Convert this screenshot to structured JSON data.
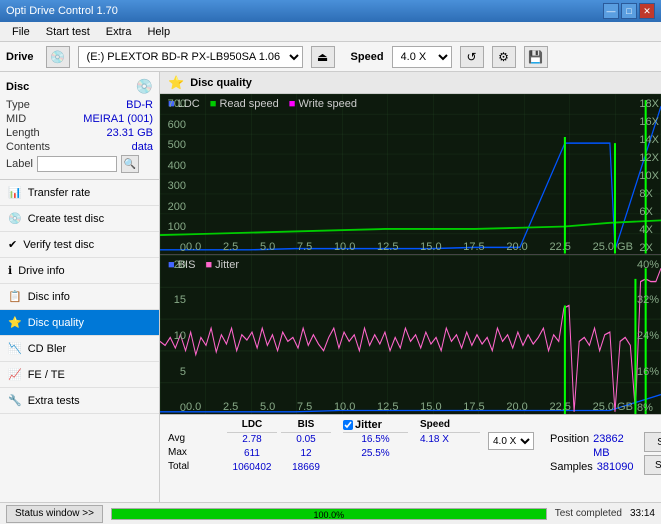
{
  "app": {
    "title": "Opti Drive Control 1.70",
    "min_btn": "—",
    "max_btn": "□",
    "close_btn": "✕"
  },
  "menu": {
    "items": [
      "File",
      "Start test",
      "Extra",
      "Help"
    ]
  },
  "drivebar": {
    "drive_label": "Drive",
    "drive_value": "(E:)  PLEXTOR BD-R  PX-LB950SA 1.06",
    "speed_label": "Speed",
    "speed_value": "4.0 X"
  },
  "disc": {
    "title": "Disc",
    "type_label": "Type",
    "type_val": "BD-R",
    "mid_label": "MID",
    "mid_val": "MEIRA1 (001)",
    "length_label": "Length",
    "length_val": "23.31 GB",
    "contents_label": "Contents",
    "contents_val": "data",
    "label_label": "Label"
  },
  "sidebar": {
    "items": [
      {
        "id": "transfer-rate",
        "label": "Transfer rate",
        "icon": "📊"
      },
      {
        "id": "create-test-disc",
        "label": "Create test disc",
        "icon": "💿"
      },
      {
        "id": "verify-test-disc",
        "label": "Verify test disc",
        "icon": "✔"
      },
      {
        "id": "drive-info",
        "label": "Drive info",
        "icon": "ℹ"
      },
      {
        "id": "disc-info",
        "label": "Disc info",
        "icon": "📋"
      },
      {
        "id": "disc-quality",
        "label": "Disc quality",
        "icon": "⭐",
        "active": true
      },
      {
        "id": "cd-bler",
        "label": "CD Bler",
        "icon": "📉"
      },
      {
        "id": "fe-te",
        "label": "FE / TE",
        "icon": "📈"
      },
      {
        "id": "extra-tests",
        "label": "Extra tests",
        "icon": "🔧"
      }
    ]
  },
  "chart_quality": {
    "title": "Disc quality",
    "legend": [
      {
        "label": "LDC",
        "color": "#0000ff"
      },
      {
        "label": "Read speed",
        "color": "#00aa00"
      },
      {
        "label": "Write speed",
        "color": "#ff00ff"
      }
    ],
    "y_max": 700,
    "y_right_max": 18,
    "x_max": 25.0,
    "y_labels_left": [
      "700",
      "600",
      "500",
      "400",
      "300",
      "200",
      "100",
      "0"
    ],
    "y_labels_right": [
      "18X",
      "16X",
      "14X",
      "12X",
      "10X",
      "8X",
      "6X",
      "4X",
      "2X"
    ],
    "x_labels": [
      "0.0",
      "2.5",
      "5.0",
      "7.5",
      "10.0",
      "12.5",
      "15.0",
      "17.5",
      "20.0",
      "22.5",
      "25.0 GB"
    ]
  },
  "chart_bis": {
    "legend": [
      {
        "label": "BIS",
        "color": "#0000ff"
      },
      {
        "label": "Jitter",
        "color": "#ff00aa"
      }
    ],
    "y_left_max": 20,
    "y_right_max": 40,
    "y_labels_left": [
      "20",
      "15",
      "10",
      "5",
      "0"
    ],
    "y_labels_right": [
      "40%",
      "32%",
      "24%",
      "16%",
      "8%"
    ],
    "x_labels": [
      "0.0",
      "2.5",
      "5.0",
      "7.5",
      "10.0",
      "12.5",
      "15.0",
      "17.5",
      "20.0",
      "22.5",
      "25.0 GB"
    ]
  },
  "stats": {
    "columns": [
      "",
      "LDC",
      "BIS",
      "",
      "Jitter",
      "Speed"
    ],
    "avg_label": "Avg",
    "max_label": "Max",
    "total_label": "Total",
    "ldc_avg": "2.78",
    "ldc_max": "611",
    "ldc_total": "1060402",
    "bis_avg": "0.05",
    "bis_max": "12",
    "bis_total": "18669",
    "jitter_avg": "16.5%",
    "jitter_max": "25.5%",
    "jitter_total": "",
    "speed_label": "Speed",
    "speed_val": "4.18 X",
    "speed_select": "4.0 X",
    "position_label": "Position",
    "position_val": "23862 MB",
    "samples_label": "Samples",
    "samples_val": "381090",
    "btn_start_full": "Start full",
    "btn_start_part": "Start part"
  },
  "statusbar": {
    "window_btn": "Status window >>",
    "progress": 100,
    "status_text": "Test completed",
    "time": "33:14"
  },
  "colors": {
    "ldc": "#0000ff",
    "read_speed": "#00bb00",
    "write_speed": "#ff00ff",
    "bis": "#0000ff",
    "jitter": "#ff66cc",
    "grid": "#ccddcc",
    "bg_chart": "#112211",
    "active_sidebar": "#0078d7"
  }
}
